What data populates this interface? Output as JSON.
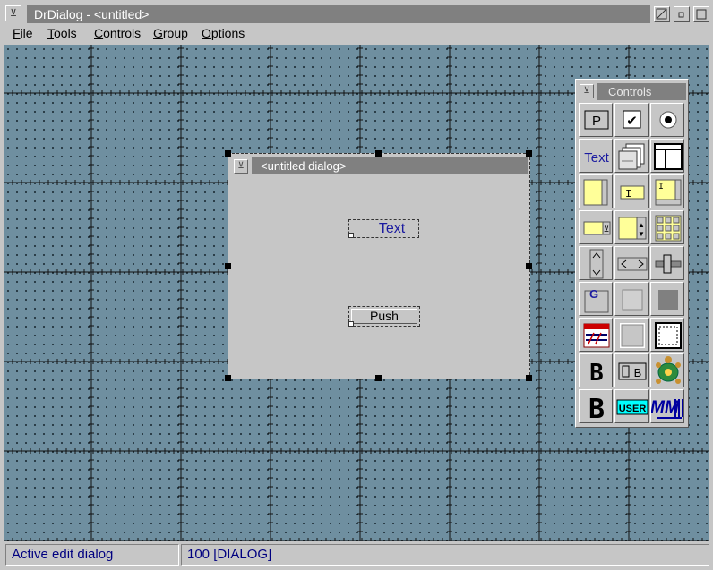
{
  "window": {
    "title": "DrDialog - <untitled>",
    "sysmenu_icon": "window-menu-icon",
    "buttons": [
      "restore-icon",
      "minimize-icon",
      "maximize-icon"
    ]
  },
  "menu": [
    {
      "label": "File",
      "key": "F"
    },
    {
      "label": "Tools",
      "key": "T"
    },
    {
      "label": "Controls",
      "key": "C"
    },
    {
      "label": "Group",
      "key": "G"
    },
    {
      "label": "Options",
      "key": "O"
    }
  ],
  "dialog": {
    "title": "<untitled dialog>",
    "text_control": "Text",
    "push_control": "Push"
  },
  "palette": {
    "title": "Controls",
    "tools": [
      {
        "name": "push-button-tool",
        "label": "P"
      },
      {
        "name": "checkbox-tool",
        "label": "✔"
      },
      {
        "name": "radio-button-tool",
        "label": ""
      },
      {
        "name": "text-tool",
        "label": "Text"
      },
      {
        "name": "notebook-tool",
        "label": ""
      },
      {
        "name": "container-tool",
        "label": ""
      },
      {
        "name": "listbox-tool",
        "label": ""
      },
      {
        "name": "entry-field-tool",
        "label": ""
      },
      {
        "name": "multiline-edit-tool",
        "label": ""
      },
      {
        "name": "combobox-tool",
        "label": ""
      },
      {
        "name": "spin-button-tool",
        "label": ""
      },
      {
        "name": "value-set-tool",
        "label": ""
      },
      {
        "name": "vertical-scrollbar-tool",
        "label": ""
      },
      {
        "name": "horizontal-scrollbar-tool",
        "label": ""
      },
      {
        "name": "slider-tool",
        "label": ""
      },
      {
        "name": "group-box-tool",
        "label": "G"
      },
      {
        "name": "frame-tool",
        "label": ""
      },
      {
        "name": "filled-rect-tool",
        "label": ""
      },
      {
        "name": "canvas-tool",
        "label": ""
      },
      {
        "name": "outline-box-tool",
        "label": ""
      },
      {
        "name": "dashed-box-tool",
        "label": ""
      },
      {
        "name": "bitmap-button-tool",
        "label": "B"
      },
      {
        "name": "icon-button-tool",
        "label": "B"
      },
      {
        "name": "turtle-icon-tool",
        "label": ""
      },
      {
        "name": "large-bitmap-tool",
        "label": "B"
      },
      {
        "name": "user-control-tool",
        "label": "USER"
      },
      {
        "name": "mmpm-control-tool",
        "label": "MM"
      }
    ]
  },
  "status": {
    "left": "Active edit dialog",
    "right": "100 [DIALOG]"
  },
  "colors": {
    "desktop": "#6f8fa0",
    "chrome": "#c6c6c6",
    "title_fill": "#808080",
    "status_text": "#000080",
    "text_blue": "#1a1aa0",
    "note_yellow": "#ffff99",
    "user_cyan": "#00ffff"
  }
}
